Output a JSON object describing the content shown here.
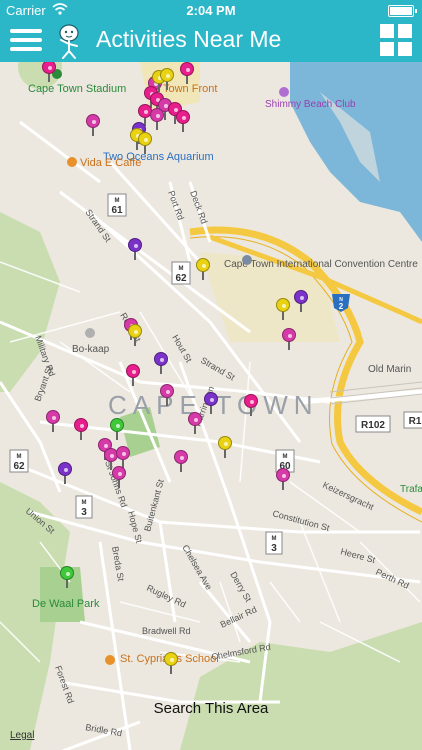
{
  "status_bar": {
    "carrier": "Carrier",
    "time": "2:04 PM"
  },
  "nav": {
    "title": "Activities Near Me",
    "menu_icon": "hamburger-icon",
    "grid_icon": "grid-icon"
  },
  "colors": {
    "header": "#2bb7c8",
    "pin_magenta": "#e81e8c",
    "pin_purple": "#7a32c8",
    "pin_yellow": "#e8d212",
    "pin_green": "#3ec83a",
    "pin_pink": "#d63aa8"
  },
  "map": {
    "labels": {
      "stadium": "Cape Town Stadium",
      "waterfront": "Town Front",
      "shimmy": "Shimmy Beach Club",
      "aquarium": "Two Oceans Aquarium",
      "vida": "Vida E Caffe",
      "portrd": "Port Rd",
      "deckrd": "Deck Rd",
      "strandst": "Strand St",
      "ctic": "Cape Town International Convention Centre",
      "bokaap": "Bo-kaap",
      "rosest": "Rose St",
      "houtst": "Hout St",
      "strandst2": "Strand St",
      "military": "Military Rd",
      "bryant": "Bryant St",
      "city": "CAPE TOWN",
      "oldmarine": "Old Marin",
      "r102": "R102",
      "stjohns": "St Johns Rd",
      "harrington": "Harrington",
      "buitenkant": "Buitenkant St",
      "hope": "Hope St",
      "union": "Union St",
      "keizersgracht": "Keizersgracht",
      "constitution": "Constitution St",
      "trafalgar": "Trafa",
      "breda": "Breda St",
      "chelsea": "Chelsea Ave",
      "derry": "Derry St",
      "heerest": "Heere St",
      "perth": "Perth Rd",
      "rugley": "Rugley Rd",
      "dewaal": "De Waal Park",
      "bradwell": "Bradwell Rd",
      "bellair": "Bellair Rd",
      "stcyprian": "St. Cyprian's School",
      "chelmsford": "Chelmsford Rd",
      "forest": "Forest Rd",
      "bridle": "Bridle Rd",
      "m61": "61",
      "m62a": "62",
      "m62b": "62",
      "m60": "60",
      "m3a": "3",
      "m3b": "3",
      "n2": "2",
      "m_prefix": "M",
      "n_prefix": "N",
      "r1": "R1"
    },
    "pins": [
      {
        "color": "#e81e8c"
      },
      {
        "color": "#d63aa8"
      },
      {
        "color": "#e8d212"
      },
      {
        "color": "#e8d212"
      },
      {
        "color": "#e81e8c"
      },
      {
        "color": "#e81e8c"
      },
      {
        "color": "#e81e8c"
      },
      {
        "color": "#d63aa8"
      },
      {
        "color": "#e81e8c"
      },
      {
        "color": "#e81e8c"
      },
      {
        "color": "#d63aa8"
      },
      {
        "color": "#e81e8c"
      },
      {
        "color": "#d63aa8"
      },
      {
        "color": "#7a32c8"
      },
      {
        "color": "#e8d212"
      },
      {
        "color": "#e8d212"
      },
      {
        "color": "#7a32c8"
      },
      {
        "color": "#7a32c8"
      },
      {
        "color": "#d63aa8"
      },
      {
        "color": "#e8d212"
      },
      {
        "color": "#e8d212"
      },
      {
        "color": "#e8d212"
      },
      {
        "color": "#d63aa8"
      },
      {
        "color": "#7a32c8"
      },
      {
        "color": "#e81e8c"
      },
      {
        "color": "#d63aa8"
      },
      {
        "color": "#d63aa8"
      },
      {
        "color": "#e81e8c"
      },
      {
        "color": "#3ec83a"
      },
      {
        "color": "#d63aa8"
      },
      {
        "color": "#d63aa8"
      },
      {
        "color": "#d63aa8"
      },
      {
        "color": "#d63aa8"
      },
      {
        "color": "#7a32c8"
      },
      {
        "color": "#7a32c8"
      },
      {
        "color": "#d63aa8"
      },
      {
        "color": "#d63aa8"
      },
      {
        "color": "#e8d212"
      },
      {
        "color": "#e81e8c"
      },
      {
        "color": "#3ec83a"
      },
      {
        "color": "#e8d212"
      },
      {
        "color": "#d63aa8"
      }
    ]
  },
  "search_area": "Search This Area",
  "legal": "Legal"
}
